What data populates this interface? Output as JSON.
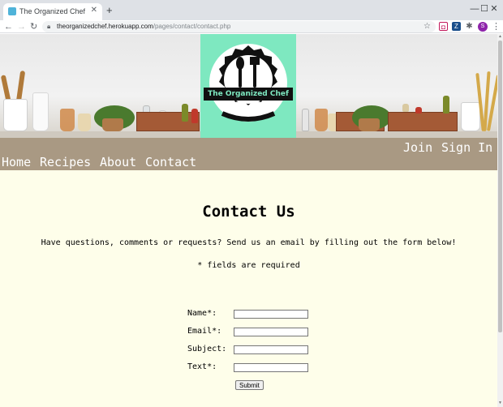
{
  "browser": {
    "tab_title": "The Organized Chef",
    "tab_close": "✕",
    "new_tab": "+",
    "url_host": "theorganizedchef.herokuapp.com",
    "url_path": "/pages/contact/contact.php",
    "profile_initial": "S",
    "window_controls": {
      "minimize": "—",
      "maximize": "☐",
      "close": "✕"
    }
  },
  "site": {
    "logo_text": "The Organized Chef",
    "nav": {
      "home": "Home",
      "recipes": "Recipes",
      "about": "About",
      "contact": "Contact",
      "join": "Join",
      "sign_in": "Sign In"
    },
    "colors": {
      "page_bg": "#fefeea",
      "nav_bg": "#a99983",
      "logo_bg": "#7ee8c0"
    }
  },
  "contact": {
    "heading": "Contact Us",
    "intro": "Have questions, comments or requests? Send us an email by filling out the form below!",
    "required_note": "* fields are required",
    "fields": {
      "name_label": "Name*:",
      "email_label": "Email*:",
      "subject_label": "Subject:",
      "text_label": "Text*:"
    },
    "submit_label": "Submit"
  }
}
